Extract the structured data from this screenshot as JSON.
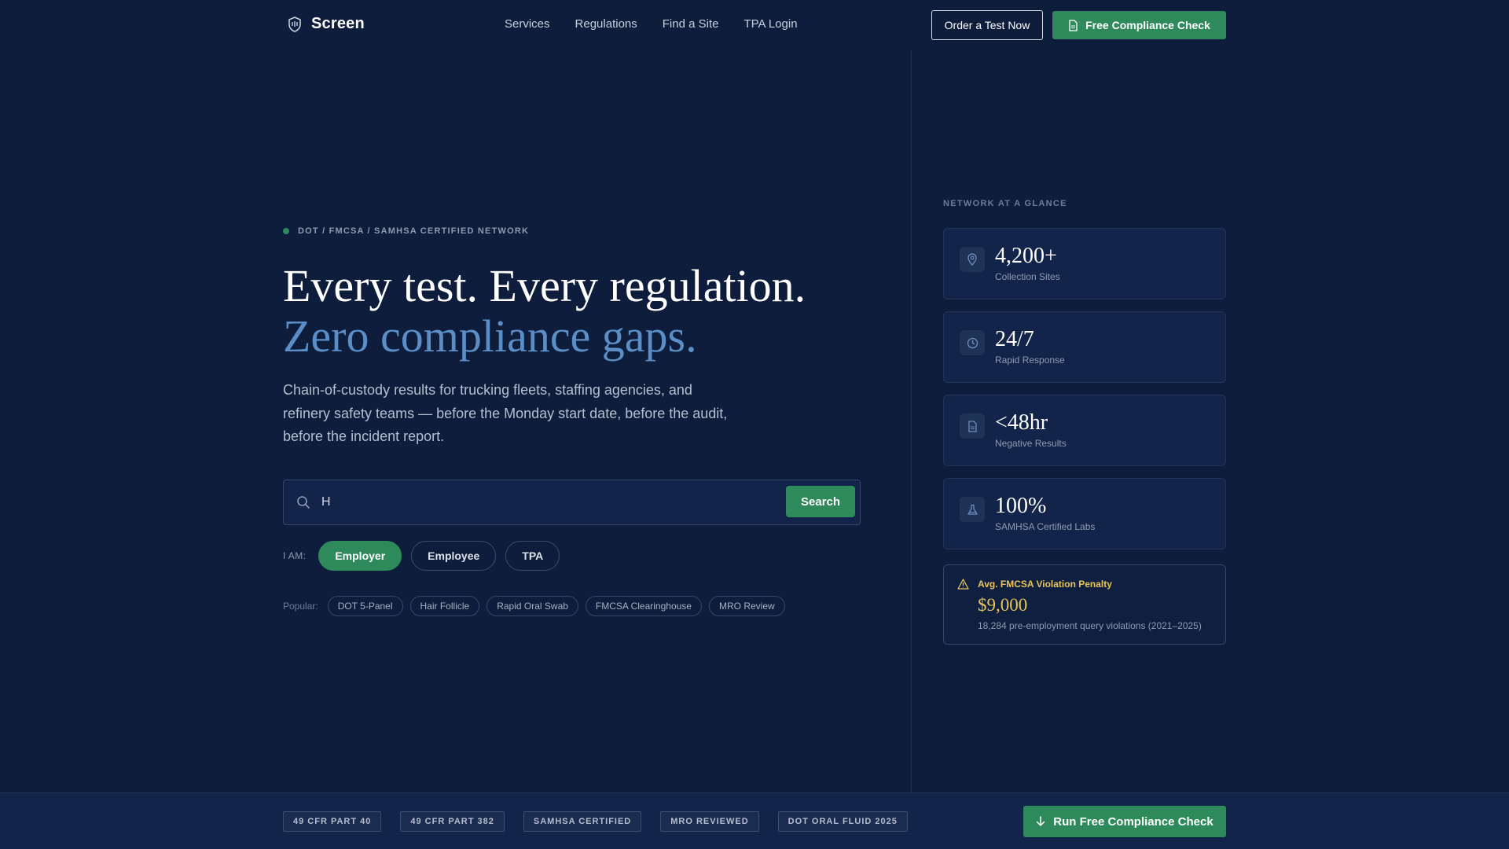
{
  "nav": {
    "brand": "Screen",
    "links": [
      "Services",
      "Regulations",
      "Find a Site",
      "TPA Login"
    ],
    "order_btn": "Order a Test Now",
    "compliance_btn": "Free Compliance Check"
  },
  "hero": {
    "eyebrow": "DOT / FMCSA / SAMHSA CERTIFIED NETWORK",
    "headline_line1": "Every test. Every regulation.",
    "headline_line2": "Zero compliance gaps.",
    "subtext": "Chain-of-custody results for trucking fleets, staffing agencies, and refinery safety teams — before the Monday start date, before the audit, before the incident report.",
    "search_value": "H",
    "search_btn": "Search",
    "iam_label": "I AM:",
    "roles": [
      {
        "label": "Employer",
        "active": true
      },
      {
        "label": "Employee",
        "active": false
      },
      {
        "label": "TPA",
        "active": false
      }
    ],
    "popular_label": "Popular:",
    "popular_tags": [
      "DOT 5-Panel",
      "Hair Follicle",
      "Rapid Oral Swab",
      "FMCSA Clearinghouse",
      "MRO Review"
    ]
  },
  "panel": {
    "title": "NETWORK AT A GLANCE",
    "stats": [
      {
        "value": "4,200+",
        "label": "Collection Sites",
        "icon": "map-pin-icon"
      },
      {
        "value": "24/7",
        "label": "Rapid Response",
        "icon": "clock-icon"
      },
      {
        "value": "<48hr",
        "label": "Negative Results",
        "icon": "document-icon"
      },
      {
        "value": "100%",
        "label": "SAMHSA Certified Labs",
        "icon": "flask-icon"
      }
    ],
    "penalty": {
      "title": "Avg. FMCSA Violation Penalty",
      "value": "$9,000",
      "note": "18,284 pre-employment query violations (2021–2025)"
    }
  },
  "footer": {
    "badges": [
      "49 CFR PART 40",
      "49 CFR PART 382",
      "SAMHSA CERTIFIED",
      "MRO REVIEWED",
      "DOT ORAL FLUID 2025"
    ],
    "cta": "Run Free Compliance Check"
  },
  "colors": {
    "background": "#0d1d3b",
    "accent_green": "#2e8a5b",
    "headline_blue": "#5b8ec7",
    "penalty_gold": "#e8c45a"
  }
}
